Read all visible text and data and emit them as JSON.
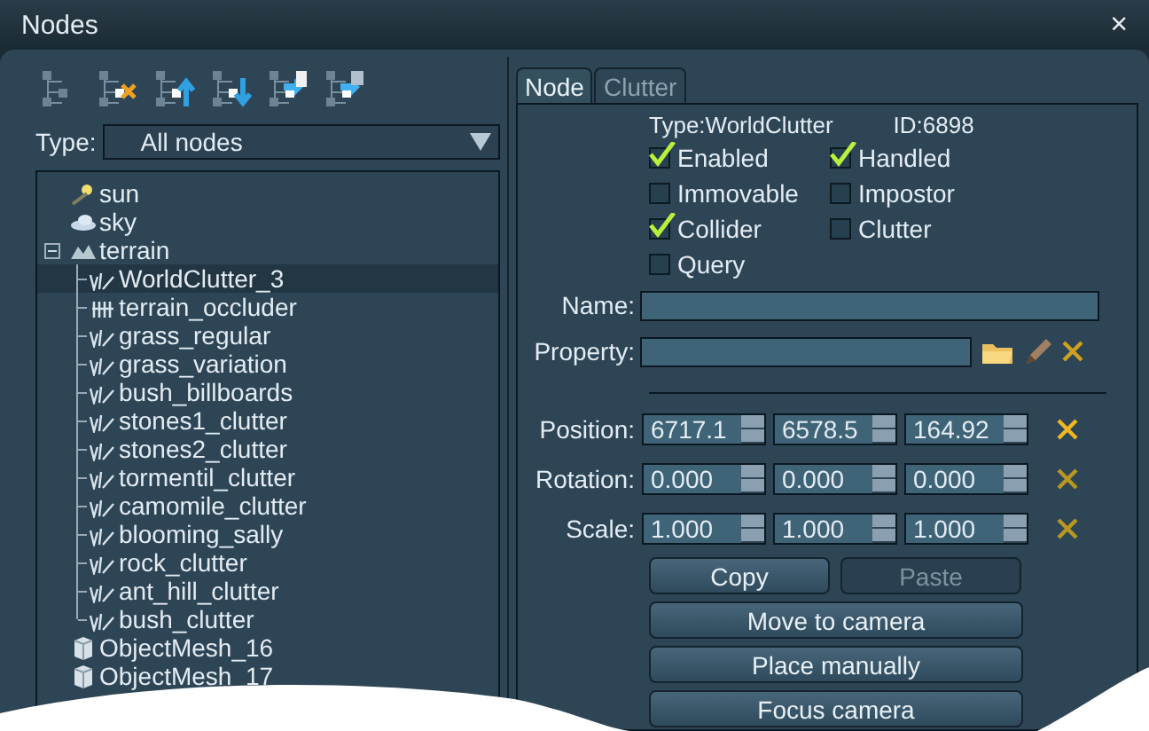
{
  "window": {
    "title": "Nodes",
    "close": "×"
  },
  "type_filter": {
    "label": "Type:",
    "value": "All nodes"
  },
  "tree": [
    {
      "label": "sun",
      "kind": "sun",
      "selected": false
    },
    {
      "label": "sky",
      "kind": "sky",
      "selected": false
    },
    {
      "label": "terrain",
      "kind": "terrain",
      "selected": false,
      "expanded": true,
      "children": [
        {
          "label": "WorldClutter_3",
          "kind": "clutter",
          "selected": true
        },
        {
          "label": "terrain_occluder",
          "kind": "occluder",
          "selected": false
        },
        {
          "label": "grass_regular",
          "kind": "clutter",
          "selected": false
        },
        {
          "label": "grass_variation",
          "kind": "clutter",
          "selected": false
        },
        {
          "label": "bush_billboards",
          "kind": "clutter",
          "selected": false
        },
        {
          "label": "stones1_clutter",
          "kind": "clutter",
          "selected": false
        },
        {
          "label": "stones2_clutter",
          "kind": "clutter",
          "selected": false
        },
        {
          "label": "tormentil_clutter",
          "kind": "clutter",
          "selected": false
        },
        {
          "label": "camomile_clutter",
          "kind": "clutter",
          "selected": false
        },
        {
          "label": "blooming_sally",
          "kind": "clutter",
          "selected": false
        },
        {
          "label": "rock_clutter",
          "kind": "clutter",
          "selected": false
        },
        {
          "label": "ant_hill_clutter",
          "kind": "clutter",
          "selected": false
        },
        {
          "label": "bush_clutter",
          "kind": "clutter",
          "selected": false
        }
      ]
    },
    {
      "label": "ObjectMesh_16",
      "kind": "mesh",
      "selected": false
    },
    {
      "label": "ObjectMesh_17",
      "kind": "mesh",
      "selected": false
    }
  ],
  "tabs": [
    {
      "label": "Node",
      "selected": true
    },
    {
      "label": "Clutter",
      "selected": false
    }
  ],
  "info": {
    "type": "Type:WorldClutter",
    "id": "ID:6898"
  },
  "flags": [
    {
      "label": "Enabled",
      "checked": true
    },
    {
      "label": "Handled",
      "checked": true
    },
    {
      "label": "Immovable",
      "checked": false
    },
    {
      "label": "Impostor",
      "checked": false
    },
    {
      "label": "Collider",
      "checked": true
    },
    {
      "label": "Clutter",
      "checked": false
    },
    {
      "label": "Query",
      "checked": false
    }
  ],
  "name_field": {
    "label": "Name:"
  },
  "property_field": {
    "label": "Property:"
  },
  "transform": [
    {
      "label": "Position:",
      "values": [
        "6717.1",
        "6578.5",
        "164.92"
      ]
    },
    {
      "label": "Rotation:",
      "values": [
        "0.000",
        "0.000",
        "0.000"
      ]
    },
    {
      "label": "Scale:",
      "values": [
        "1.000",
        "1.000",
        "1.000"
      ]
    }
  ],
  "buttons": [
    {
      "label": "Copy",
      "disabled": false
    },
    {
      "label": "Paste",
      "disabled": true
    },
    {
      "label": "Move to camera",
      "disabled": false
    },
    {
      "label": "Place manually",
      "disabled": false
    },
    {
      "label": "Focus camera",
      "disabled": false
    }
  ]
}
